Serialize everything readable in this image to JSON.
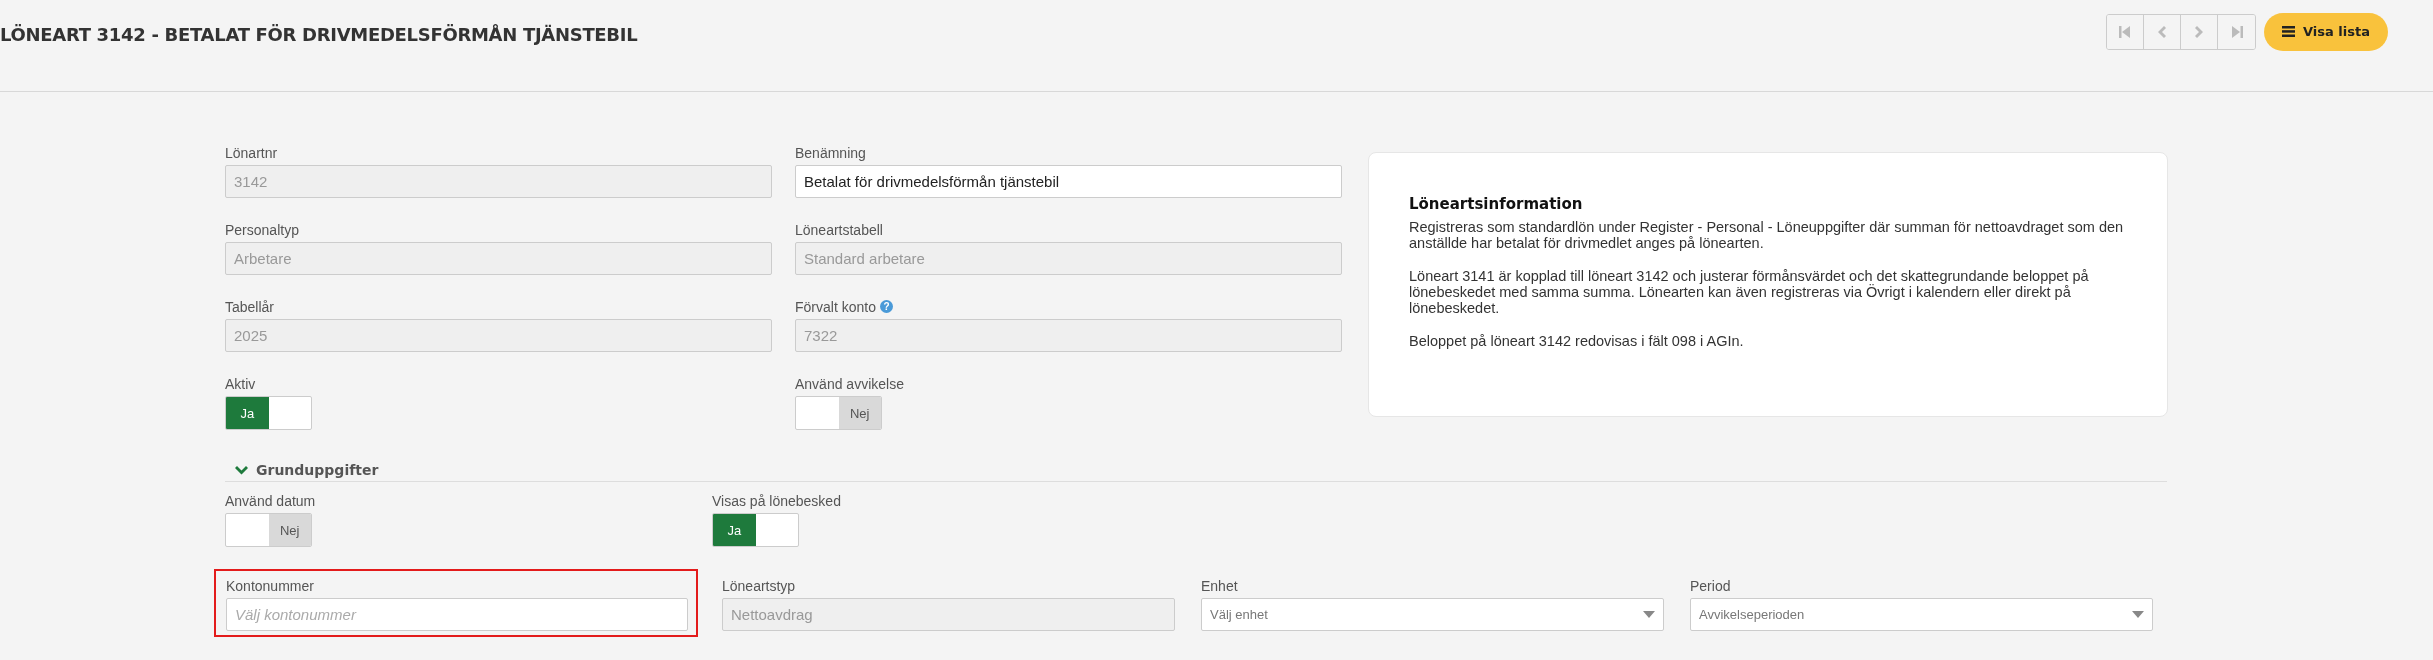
{
  "header": {
    "title": "LÖNEART 3142 - BETALAT FÖR DRIVMEDELSFÖRMÅN TJÄNSTEBIL",
    "nav_buttons": [
      {
        "kind": "first",
        "disabled": true
      },
      {
        "kind": "prev",
        "disabled": true
      },
      {
        "kind": "next",
        "disabled": true
      },
      {
        "kind": "last",
        "disabled": true
      }
    ],
    "list_button": {
      "label": "Visa lista"
    }
  },
  "form": {
    "rows": [
      [
        {
          "label": "Lönartnr",
          "kind": "text",
          "value": "3142",
          "disabled": true
        },
        {
          "label": "Benämning",
          "kind": "text",
          "value": "Betalat för drivmedelsförmån tjänstebil",
          "disabled": false
        }
      ],
      [
        {
          "label": "Personaltyp",
          "kind": "text",
          "value": "Arbetare",
          "disabled": true
        },
        {
          "label": "Löneartstabell",
          "kind": "text",
          "value": "Standard arbetare",
          "disabled": true
        }
      ],
      [
        {
          "label": "Tabellår",
          "kind": "text",
          "value": "2025",
          "disabled": true
        },
        {
          "label": "Förvalt konto",
          "kind": "text",
          "value": "7322",
          "disabled": true,
          "help": "?"
        }
      ],
      [
        {
          "label": "Aktiv",
          "kind": "toggle",
          "on": true,
          "text": "Ja"
        },
        {
          "label": "Använd avvikelse",
          "kind": "toggle",
          "on": false,
          "text": "Nej"
        }
      ]
    ]
  },
  "info": {
    "title": "Löneartsinformation",
    "paragraphs": [
      "Registreras som standardlön under Register - Personal - Löneuppgifter där summan för nettoavdraget som den anställde har betalat för drivmedlet anges på lönearten.",
      "Löneart 3141 är kopplad till löneart 3142 och justerar förmånsvärdet och det skattegrundande beloppet på lönebeskedet med samma summa. Lönearten kan även registreras via Övrigt i kalendern eller direkt på lönebeskedet.",
      "Beloppet på löneart 3142 redovisas i fält 098 i AGIn."
    ]
  },
  "section": {
    "title": "Grunduppgifter",
    "expanded": true,
    "toggles": [
      {
        "label": "Använd datum",
        "on": false,
        "text": "Nej"
      },
      {
        "label": "Visas på lönebesked",
        "on": true,
        "text": "Ja"
      }
    ],
    "fields": [
      {
        "label": "Kontonummer",
        "kind": "text",
        "placeholder": "Välj kontonummer",
        "disabled": false,
        "highlighted": true
      },
      {
        "label": "Löneartstyp",
        "kind": "text",
        "value": "Nettoavdrag",
        "disabled": true,
        "highlighted": false
      },
      {
        "label": "Enhet",
        "kind": "select",
        "value": "Välj enhet",
        "disabled": false,
        "highlighted": false
      },
      {
        "label": "Period",
        "kind": "select",
        "value": "Avvikelseperioden",
        "disabled": false,
        "highlighted": false
      }
    ]
  }
}
